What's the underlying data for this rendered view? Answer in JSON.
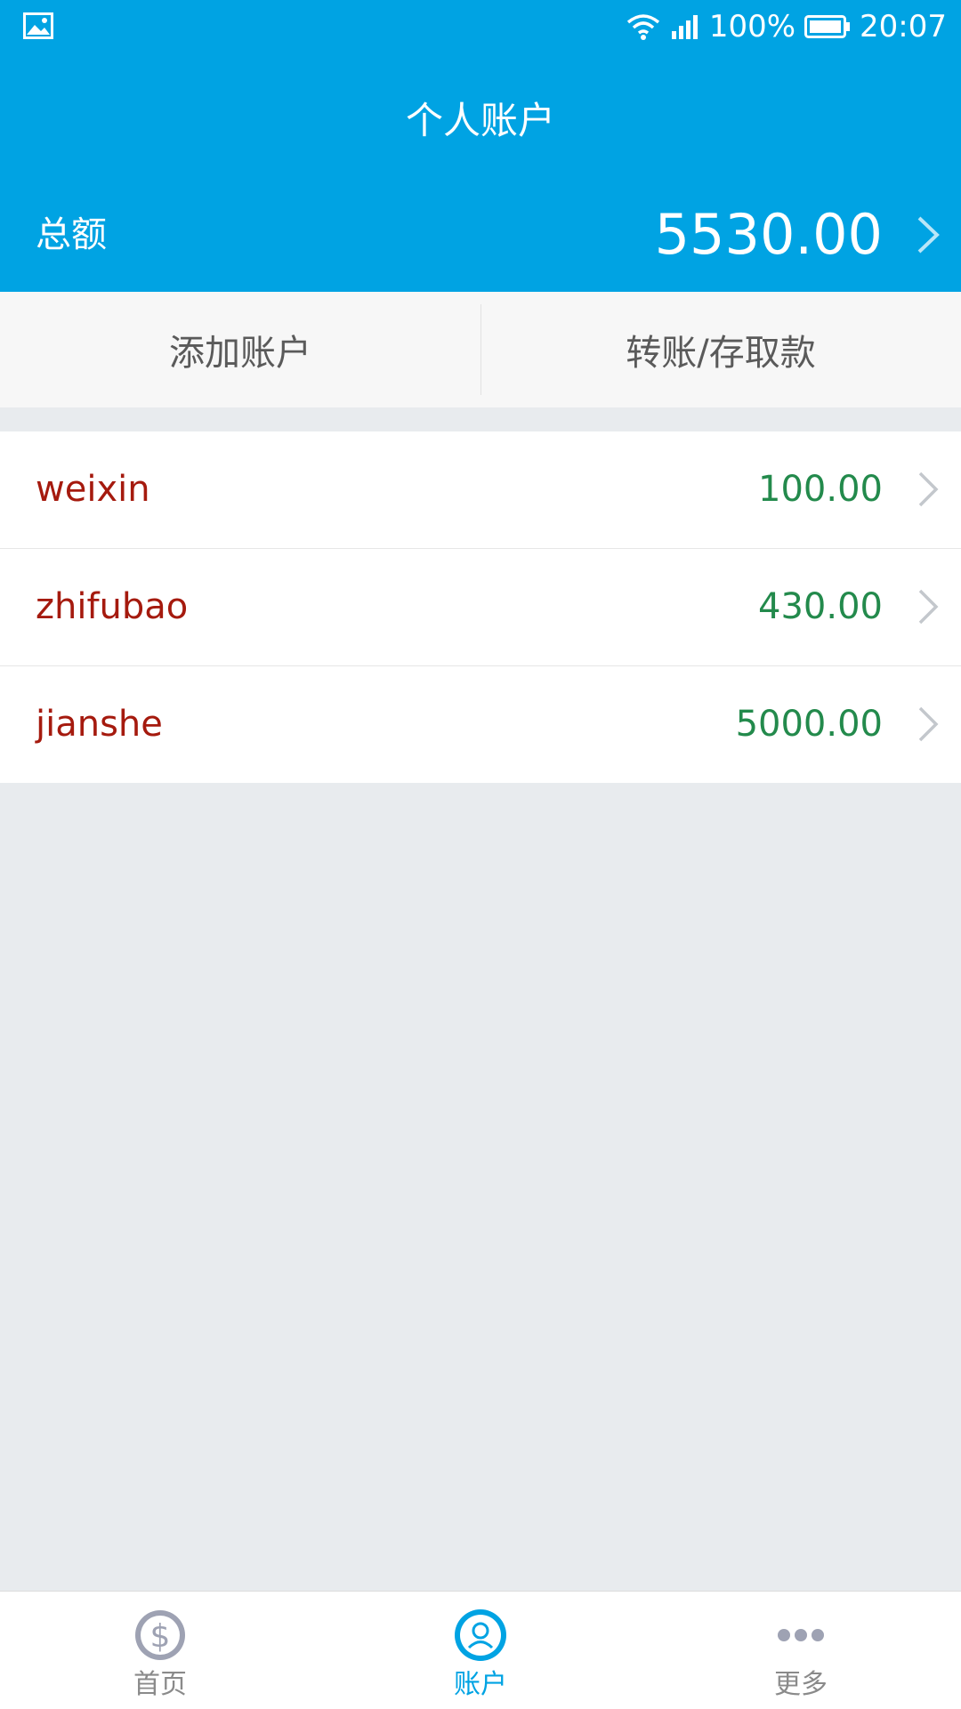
{
  "status_bar": {
    "battery": "100%",
    "time": "20:07"
  },
  "header": {
    "title": "个人账户",
    "total_label": "总额",
    "total_amount": "5530.00"
  },
  "actions": {
    "add_account": "添加账户",
    "transfer": "转账/存取款"
  },
  "accounts": [
    {
      "name": "weixin",
      "amount": "100.00"
    },
    {
      "name": "zhifubao",
      "amount": "430.00"
    },
    {
      "name": "jianshe",
      "amount": "5000.00"
    }
  ],
  "tabs": [
    {
      "label": "首页",
      "icon": "dollar-coin-icon",
      "active": false
    },
    {
      "label": "账户",
      "icon": "user-icon",
      "active": true
    },
    {
      "label": "更多",
      "icon": "more-dots-icon",
      "active": false
    }
  ],
  "colors": {
    "primary": "#00a3e3",
    "account_name": "#a51a0e",
    "account_amount": "#238a4c",
    "inactive_tab": "#8a8a8a"
  }
}
